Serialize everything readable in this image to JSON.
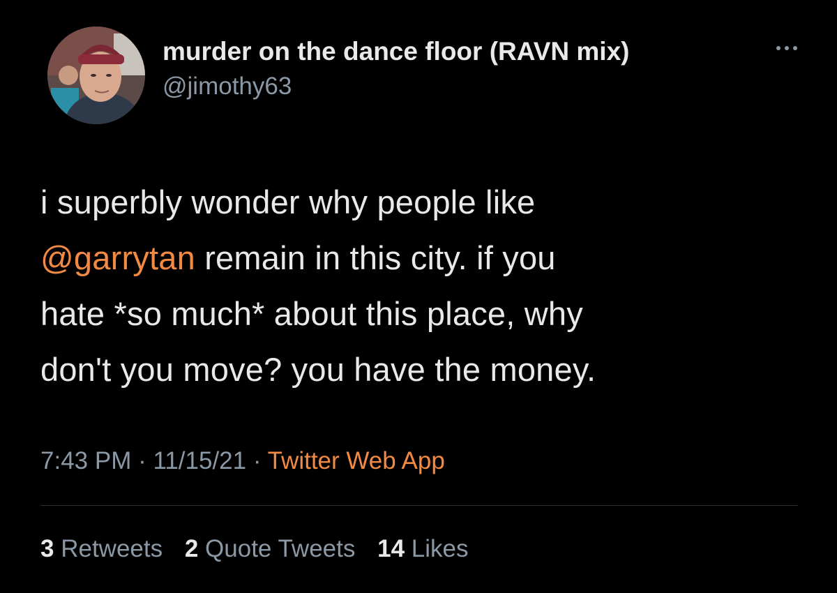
{
  "tweet": {
    "author": {
      "display_name": "murder on the dance floor (RAVN mix)",
      "handle": "@jimothy63"
    },
    "text": {
      "line1": "i superbly wonder why people like",
      "mention": "@garrytan",
      "line2_rest": " remain in this city. if you",
      "line3": "hate *so much* about this place, why",
      "line4": "don't you move? you have the money."
    },
    "meta": {
      "time": "7:43 PM",
      "separator1": " · ",
      "date": "11/15/21",
      "separator2": " · ",
      "source": "Twitter Web App"
    },
    "stats": {
      "retweets_count": "3",
      "retweets_label": "Retweets",
      "quotes_count": "2",
      "quotes_label": "Quote Tweets",
      "likes_count": "14",
      "likes_label": "Likes"
    }
  },
  "colors": {
    "background": "#000000",
    "text": "#e7e9ea",
    "secondary": "#8b98a5",
    "accent": "#f28a44"
  },
  "icons": {
    "more": "more-dots-icon",
    "avatar": "profile-photo"
  }
}
